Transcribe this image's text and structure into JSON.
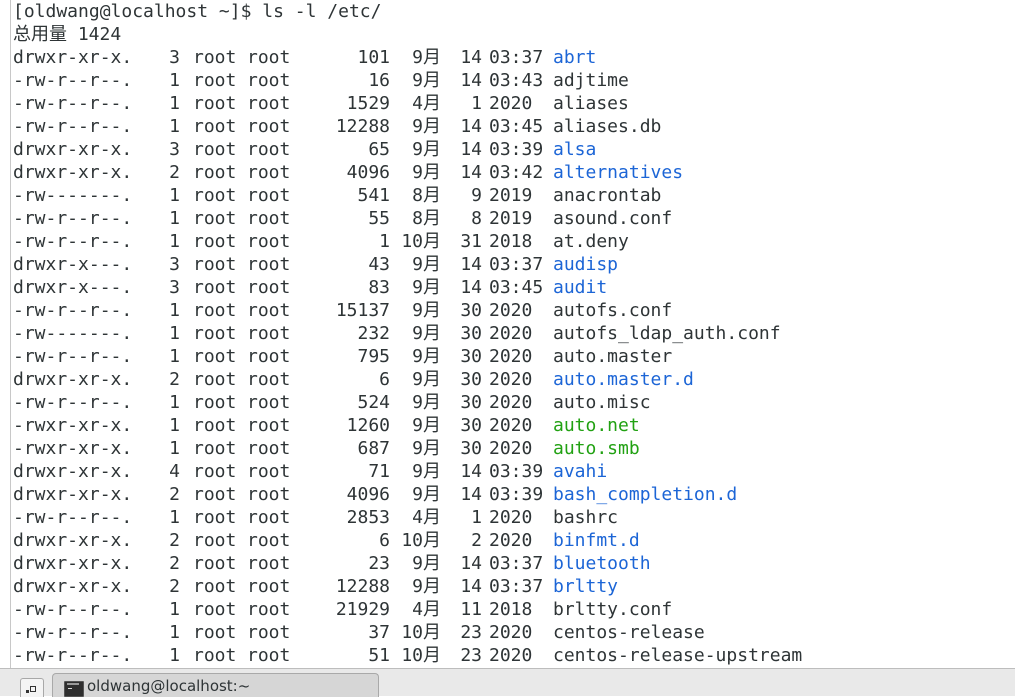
{
  "terminal": {
    "prompt": "[oldwang@localhost ~]$ ls -l /etc/",
    "total": "总用量 1424",
    "entries": [
      {
        "perm": "drwxr-xr-x.",
        "links": "3",
        "user": "root",
        "group": "root",
        "size": "101",
        "month": "9月",
        "day": "14",
        "time": "03:37",
        "name": "abrt",
        "type": "dir"
      },
      {
        "perm": "-rw-r--r--.",
        "links": "1",
        "user": "root",
        "group": "root",
        "size": "16",
        "month": "9月",
        "day": "14",
        "time": "03:43",
        "name": "adjtime",
        "type": "file"
      },
      {
        "perm": "-rw-r--r--.",
        "links": "1",
        "user": "root",
        "group": "root",
        "size": "1529",
        "month": "4月",
        "day": "1",
        "time": "2020",
        "name": "aliases",
        "type": "file"
      },
      {
        "perm": "-rw-r--r--.",
        "links": "1",
        "user": "root",
        "group": "root",
        "size": "12288",
        "month": "9月",
        "day": "14",
        "time": "03:45",
        "name": "aliases.db",
        "type": "file"
      },
      {
        "perm": "drwxr-xr-x.",
        "links": "3",
        "user": "root",
        "group": "root",
        "size": "65",
        "month": "9月",
        "day": "14",
        "time": "03:39",
        "name": "alsa",
        "type": "dir"
      },
      {
        "perm": "drwxr-xr-x.",
        "links": "2",
        "user": "root",
        "group": "root",
        "size": "4096",
        "month": "9月",
        "day": "14",
        "time": "03:42",
        "name": "alternatives",
        "type": "dir"
      },
      {
        "perm": "-rw-------.",
        "links": "1",
        "user": "root",
        "group": "root",
        "size": "541",
        "month": "8月",
        "day": "9",
        "time": "2019",
        "name": "anacrontab",
        "type": "file"
      },
      {
        "perm": "-rw-r--r--.",
        "links": "1",
        "user": "root",
        "group": "root",
        "size": "55",
        "month": "8月",
        "day": "8",
        "time": "2019",
        "name": "asound.conf",
        "type": "file"
      },
      {
        "perm": "-rw-r--r--.",
        "links": "1",
        "user": "root",
        "group": "root",
        "size": "1",
        "month": "10月",
        "day": "31",
        "time": "2018",
        "name": "at.deny",
        "type": "file"
      },
      {
        "perm": "drwxr-x---.",
        "links": "3",
        "user": "root",
        "group": "root",
        "size": "43",
        "month": "9月",
        "day": "14",
        "time": "03:37",
        "name": "audisp",
        "type": "dir"
      },
      {
        "perm": "drwxr-x---.",
        "links": "3",
        "user": "root",
        "group": "root",
        "size": "83",
        "month": "9月",
        "day": "14",
        "time": "03:45",
        "name": "audit",
        "type": "dir"
      },
      {
        "perm": "-rw-r--r--.",
        "links": "1",
        "user": "root",
        "group": "root",
        "size": "15137",
        "month": "9月",
        "day": "30",
        "time": "2020",
        "name": "autofs.conf",
        "type": "file"
      },
      {
        "perm": "-rw-------.",
        "links": "1",
        "user": "root",
        "group": "root",
        "size": "232",
        "month": "9月",
        "day": "30",
        "time": "2020",
        "name": "autofs_ldap_auth.conf",
        "type": "file"
      },
      {
        "perm": "-rw-r--r--.",
        "links": "1",
        "user": "root",
        "group": "root",
        "size": "795",
        "month": "9月",
        "day": "30",
        "time": "2020",
        "name": "auto.master",
        "type": "file"
      },
      {
        "perm": "drwxr-xr-x.",
        "links": "2",
        "user": "root",
        "group": "root",
        "size": "6",
        "month": "9月",
        "day": "30",
        "time": "2020",
        "name": "auto.master.d",
        "type": "dir"
      },
      {
        "perm": "-rw-r--r--.",
        "links": "1",
        "user": "root",
        "group": "root",
        "size": "524",
        "month": "9月",
        "day": "30",
        "time": "2020",
        "name": "auto.misc",
        "type": "file"
      },
      {
        "perm": "-rwxr-xr-x.",
        "links": "1",
        "user": "root",
        "group": "root",
        "size": "1260",
        "month": "9月",
        "day": "30",
        "time": "2020",
        "name": "auto.net",
        "type": "exec"
      },
      {
        "perm": "-rwxr-xr-x.",
        "links": "1",
        "user": "root",
        "group": "root",
        "size": "687",
        "month": "9月",
        "day": "30",
        "time": "2020",
        "name": "auto.smb",
        "type": "exec"
      },
      {
        "perm": "drwxr-xr-x.",
        "links": "4",
        "user": "root",
        "group": "root",
        "size": "71",
        "month": "9月",
        "day": "14",
        "time": "03:39",
        "name": "avahi",
        "type": "dir"
      },
      {
        "perm": "drwxr-xr-x.",
        "links": "2",
        "user": "root",
        "group": "root",
        "size": "4096",
        "month": "9月",
        "day": "14",
        "time": "03:39",
        "name": "bash_completion.d",
        "type": "dir"
      },
      {
        "perm": "-rw-r--r--.",
        "links": "1",
        "user": "root",
        "group": "root",
        "size": "2853",
        "month": "4月",
        "day": "1",
        "time": "2020",
        "name": "bashrc",
        "type": "file"
      },
      {
        "perm": "drwxr-xr-x.",
        "links": "2",
        "user": "root",
        "group": "root",
        "size": "6",
        "month": "10月",
        "day": "2",
        "time": "2020",
        "name": "binfmt.d",
        "type": "dir"
      },
      {
        "perm": "drwxr-xr-x.",
        "links": "2",
        "user": "root",
        "group": "root",
        "size": "23",
        "month": "9月",
        "day": "14",
        "time": "03:37",
        "name": "bluetooth",
        "type": "dir"
      },
      {
        "perm": "drwxr-xr-x.",
        "links": "2",
        "user": "root",
        "group": "root",
        "size": "12288",
        "month": "9月",
        "day": "14",
        "time": "03:37",
        "name": "brltty",
        "type": "dir"
      },
      {
        "perm": "-rw-r--r--.",
        "links": "1",
        "user": "root",
        "group": "root",
        "size": "21929",
        "month": "4月",
        "day": "11",
        "time": "2018",
        "name": "brltty.conf",
        "type": "file"
      },
      {
        "perm": "-rw-r--r--.",
        "links": "1",
        "user": "root",
        "group": "root",
        "size": "37",
        "month": "10月",
        "day": "23",
        "time": "2020",
        "name": "centos-release",
        "type": "file"
      },
      {
        "perm": "-rw-r--r--.",
        "links": "1",
        "user": "root",
        "group": "root",
        "size": "51",
        "month": "10月",
        "day": "23",
        "time": "2020",
        "name": "centos-release-upstream",
        "type": "file"
      }
    ]
  },
  "taskbar": {
    "window_label": "oldwang@localhost:~",
    "show_desktop_icon": "show-desktop-icon",
    "terminal_icon": "terminal-icon"
  },
  "colors": {
    "directory": "#1c65d6",
    "executable": "#21a112",
    "text": "#2e3436"
  }
}
